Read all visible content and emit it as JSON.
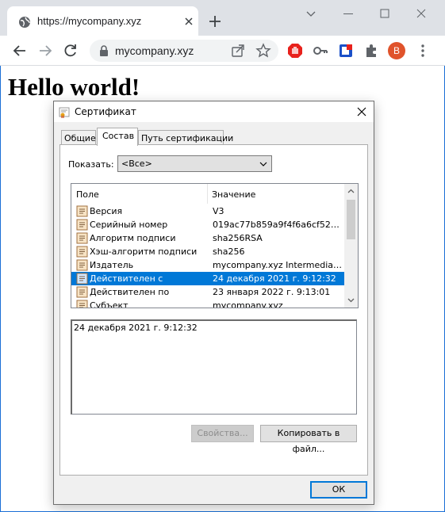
{
  "browser": {
    "tab_title": "https://mycompany.xyz",
    "address": "mycompany.xyz",
    "profile_initial": "B",
    "accent": "#1a6fd6"
  },
  "page": {
    "heading": "Hello world!"
  },
  "dialog": {
    "title": "Сертификат",
    "tabs": [
      "Общие",
      "Состав",
      "Путь сертификации"
    ],
    "active_tab": "Состав",
    "show_label": "Показать:",
    "show_value": "<Все>",
    "columns": [
      "Поле",
      "Значение"
    ],
    "fields": [
      {
        "field": "Версия",
        "value": "V3"
      },
      {
        "field": "Серийный номер",
        "value": "019ac77b859a9f4f6a6cf5234..."
      },
      {
        "field": "Алгоритм подписи",
        "value": "sha256RSA"
      },
      {
        "field": "Хэш-алгоритм подписи",
        "value": "sha256"
      },
      {
        "field": "Издатель",
        "value": "mycompany.xyz Intermediate ..."
      },
      {
        "field": "Действителен с",
        "value": "24 декабря 2021 г. 9:12:32"
      },
      {
        "field": "Действителен по",
        "value": "23 января 2022 г. 9:13:01"
      },
      {
        "field": "Субъект",
        "value": "mycompany.xyz"
      }
    ],
    "selected_index": 5,
    "detail_text": "24 декабря 2021 г. 9:12:32",
    "properties_button": "Свойства...",
    "copy_button": "Копировать в файл...",
    "ok_button": "ОК",
    "selection_color": "#0078d7"
  }
}
